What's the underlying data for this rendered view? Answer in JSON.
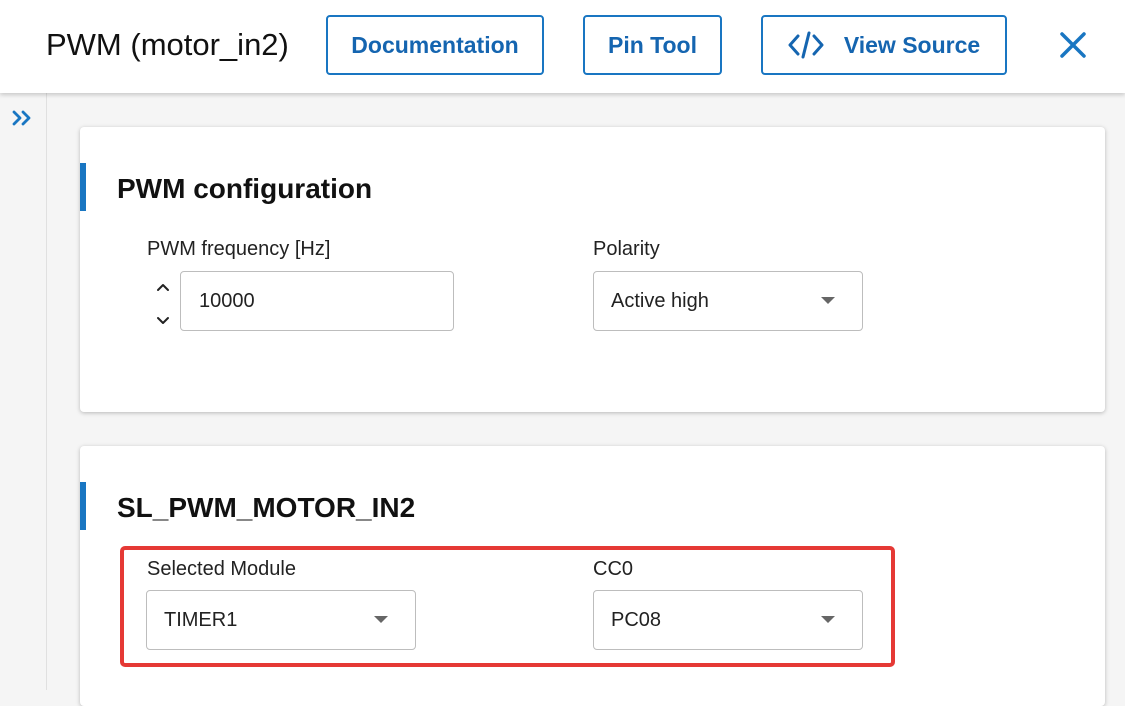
{
  "header": {
    "title": "PWM (motor_in2)",
    "documentation_label": "Documentation",
    "pin_tool_label": "Pin Tool",
    "view_source_label": "View Source",
    "icons": {
      "view_source": "code-icon",
      "close": "close-icon"
    }
  },
  "sidebar": {
    "expand_icon": "double-chevron-right-icon"
  },
  "pwm_configuration": {
    "title": "PWM configuration",
    "frequency": {
      "label": "PWM frequency [Hz]",
      "value": "10000"
    },
    "polarity": {
      "label": "Polarity",
      "value": "Active high"
    }
  },
  "instance": {
    "title": "SL_PWM_MOTOR_IN2",
    "module": {
      "label": "Selected Module",
      "value": "TIMER1"
    },
    "cc0": {
      "label": "CC0",
      "value": "PC08"
    }
  },
  "colors": {
    "accent": "#1976c2",
    "highlight": "#e53935"
  }
}
